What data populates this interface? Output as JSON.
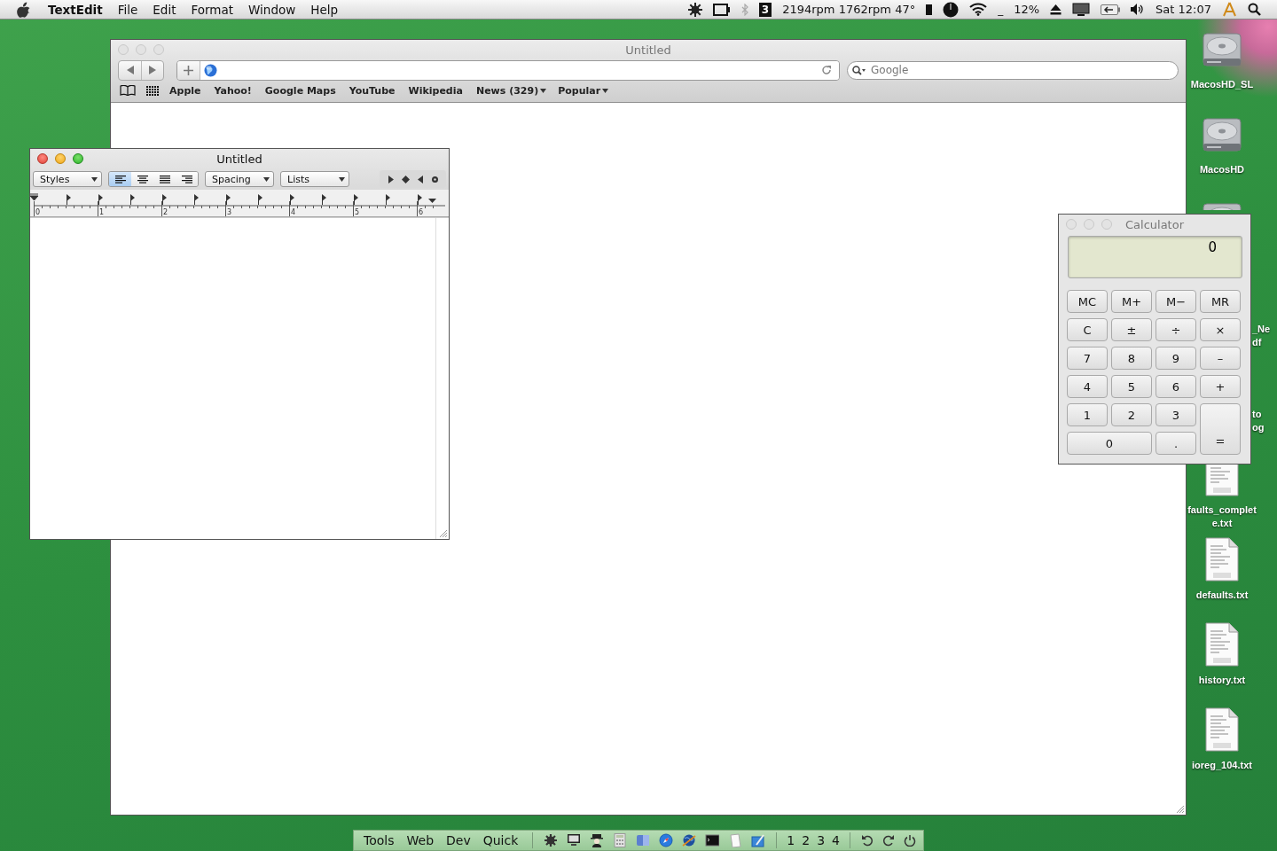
{
  "menu_bar": {
    "app": "TextEdit",
    "menus": [
      "File",
      "Edit",
      "Format",
      "Window",
      "Help"
    ],
    "fan_badge": "3",
    "sensors": "2194rpm 1762rpm 47°",
    "mark": "_",
    "battery": "12%",
    "clock": "Sat 12:07"
  },
  "browser_window": {
    "title": "Untitled",
    "active": false,
    "search": {
      "placeholder": "Google"
    },
    "bookmarks": [
      {
        "label": "Apple",
        "menu": false
      },
      {
        "label": "Yahoo!",
        "menu": false
      },
      {
        "label": "Google Maps",
        "menu": false
      },
      {
        "label": "YouTube",
        "menu": false
      },
      {
        "label": "Wikipedia",
        "menu": false
      },
      {
        "label": "News (329)",
        "menu": true
      },
      {
        "label": "Popular",
        "menu": true
      }
    ]
  },
  "textedit_window": {
    "title": "Untitled",
    "active": true,
    "popups": [
      "Styles",
      "Spacing",
      "Lists"
    ],
    "alignment": [
      {
        "kind": "left",
        "selected": true
      },
      {
        "kind": "center",
        "selected": false
      },
      {
        "kind": "justify",
        "selected": false
      },
      {
        "kind": "right",
        "selected": false
      }
    ],
    "ruler_numbers": [
      "0",
      "1",
      "2",
      "3",
      "4",
      "5",
      "6"
    ]
  },
  "calculator": {
    "title": "Calculator",
    "active": false,
    "display": "0",
    "keys": [
      {
        "label": "MC",
        "kind": "normal"
      },
      {
        "label": "M+",
        "kind": "normal"
      },
      {
        "label": "M−",
        "kind": "normal"
      },
      {
        "label": "MR",
        "kind": "normal"
      },
      {
        "label": "C",
        "kind": "normal"
      },
      {
        "label": "±",
        "kind": "normal"
      },
      {
        "label": "÷",
        "kind": "normal"
      },
      {
        "label": "×",
        "kind": "normal"
      },
      {
        "label": "7",
        "kind": "normal"
      },
      {
        "label": "8",
        "kind": "normal"
      },
      {
        "label": "9",
        "kind": "normal"
      },
      {
        "label": "–",
        "kind": "normal"
      },
      {
        "label": "4",
        "kind": "normal"
      },
      {
        "label": "5",
        "kind": "normal"
      },
      {
        "label": "6",
        "kind": "normal"
      },
      {
        "label": "+",
        "kind": "normal"
      },
      {
        "label": "1",
        "kind": "normal"
      },
      {
        "label": "2",
        "kind": "normal"
      },
      {
        "label": "3",
        "kind": "normal"
      },
      {
        "label": "0",
        "kind": "wide"
      },
      {
        "label": ".",
        "kind": "normal"
      },
      {
        "label": "=",
        "kind": "tall"
      }
    ]
  },
  "desktop_icons": [
    {
      "kind": "disk",
      "lines": [
        "MacosHD_SL"
      ]
    },
    {
      "kind": "disk",
      "lines": [
        "MacosHD"
      ]
    },
    {
      "kind": "covered-disk"
    },
    {
      "kind": "partial",
      "lines": [
        "_Ne",
        "df"
      ]
    },
    {
      "kind": "partial",
      "lines": [
        "to",
        "og"
      ]
    },
    {
      "kind": "covered-text-file",
      "lines": [
        "faults_complet",
        "e.txt"
      ]
    },
    {
      "kind": "text-file",
      "lines": [
        "defaults.txt"
      ]
    },
    {
      "kind": "text-file",
      "lines": [
        "history.txt"
      ]
    },
    {
      "kind": "text-file",
      "lines": [
        "ioreg_104.txt"
      ]
    }
  ],
  "launcher_bar": {
    "menus": [
      "Tools",
      "Web",
      "Dev",
      "Quick"
    ],
    "spaces": [
      "1",
      "2",
      "3",
      "4"
    ]
  }
}
